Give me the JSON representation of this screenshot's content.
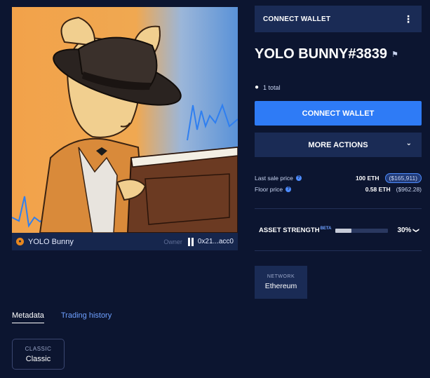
{
  "nft": {
    "collection_icon": "collection-badge-icon",
    "collection_name": "YOLO Bunny",
    "owner_label": "Owner",
    "owner_avatar_icon": "pixel-avatar-icon",
    "owner_address": "0x21...acc0"
  },
  "tabs": {
    "metadata": "Metadata",
    "trading_history": "Trading history"
  },
  "trait": {
    "type": "CLASSIC",
    "value": "Classic"
  },
  "top_bar": {
    "label": "CONNECT WALLET",
    "menu_icon": "kebab-menu-icon"
  },
  "asset": {
    "title": "YOLO BUNNY#3839",
    "flag_icon": "flag-icon",
    "total": "1 total"
  },
  "actions": {
    "connect_wallet": "CONNECT WALLET",
    "more_actions": "MORE ACTIONS"
  },
  "prices": {
    "last_sale_label": "Last sale price",
    "last_sale_eth": "100 ETH",
    "last_sale_usd": "($165,911)",
    "floor_label": "Floor price",
    "floor_eth": "0.58 ETH",
    "floor_usd": "($962.28)"
  },
  "strength": {
    "label": "ASSET STRENGTH",
    "beta": "BETA",
    "value": "30%",
    "fraction": 0.3
  },
  "network": {
    "label": "NETWORK",
    "value": "Ethereum"
  },
  "colors": {
    "background": "#0c1530",
    "panel": "#1a2b55",
    "accent_blue": "#2e7bf6",
    "link_blue": "#6ea0ff",
    "art_orange": "#f2a24a"
  }
}
